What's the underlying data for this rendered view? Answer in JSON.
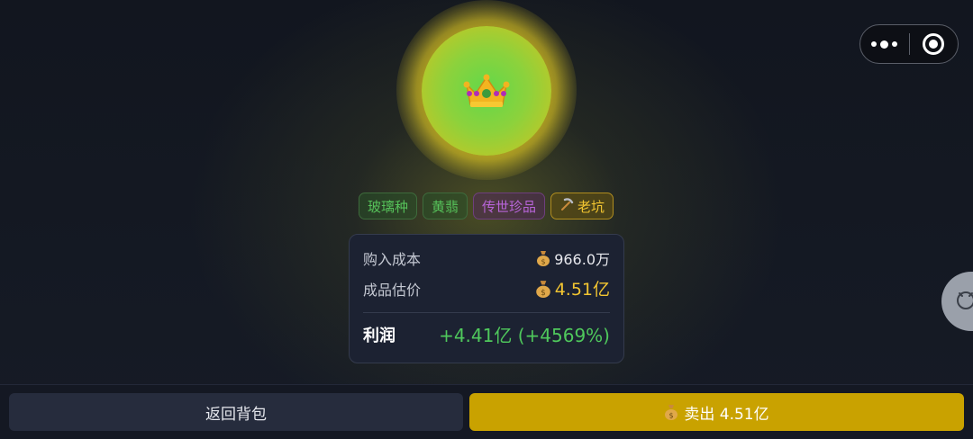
{
  "item": {
    "icon": "crown-icon"
  },
  "tags": [
    {
      "label": "玻璃种",
      "style": "green"
    },
    {
      "label": "黄翡",
      "style": "green"
    },
    {
      "label": "传世珍品",
      "style": "purple"
    },
    {
      "label": "老坑",
      "style": "gold",
      "icon": "pickaxe-icon"
    }
  ],
  "stats": {
    "cost_label": "购入成本",
    "cost_value": "966.0万",
    "estimate_label": "成品估价",
    "estimate_value": "4.51亿",
    "profit_label": "利润",
    "profit_value": "+4.41亿 (+4569%)"
  },
  "actions": {
    "back_label": "返回背包",
    "sell_label": "卖出 4.51亿"
  },
  "colors": {
    "accent_gold": "#c9a200",
    "profit_green": "#4fc85c",
    "tag_purple": "#b764d8"
  }
}
